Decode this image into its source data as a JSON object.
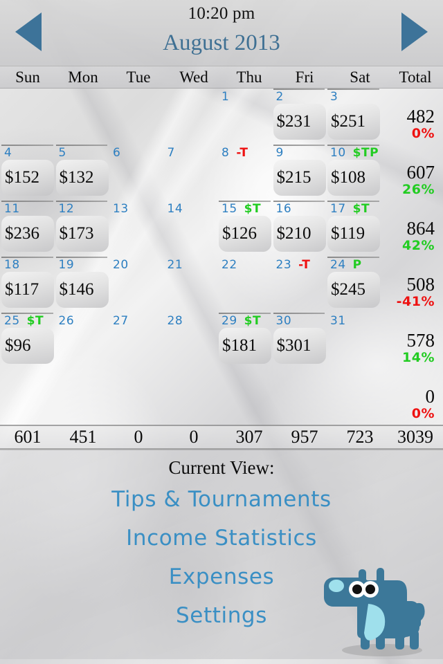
{
  "header": {
    "clock": "10:20 pm",
    "month_title": "August 2013",
    "prev_label": "prev-month",
    "next_label": "next-month"
  },
  "day_headers": [
    "Sun",
    "Mon",
    "Tue",
    "Wed",
    "Thu",
    "Fri",
    "Sat",
    "Total"
  ],
  "colors": {
    "accent_blue": "#3d7399",
    "daynum_blue": "#2d7fc1",
    "marker_green": "#22cc22",
    "marker_red": "#ee1111",
    "menu_blue": "#3a8fc4",
    "dog_body": "#3c7899",
    "dog_spot": "#9fe0ec"
  },
  "weeks": [
    {
      "days": [
        {
          "num": "",
          "amount": "",
          "marks": []
        },
        {
          "num": "",
          "amount": "",
          "marks": []
        },
        {
          "num": "",
          "amount": "",
          "marks": []
        },
        {
          "num": "",
          "amount": "",
          "marks": []
        },
        {
          "num": "1",
          "amount": "",
          "marks": []
        },
        {
          "num": "2",
          "amount": "$231",
          "marks": []
        },
        {
          "num": "3",
          "amount": "$251",
          "marks": []
        }
      ],
      "total": "482",
      "pct": "0%",
      "pct_sign": "neg"
    },
    {
      "days": [
        {
          "num": "4",
          "amount": "$152",
          "marks": []
        },
        {
          "num": "5",
          "amount": "$132",
          "marks": []
        },
        {
          "num": "6",
          "amount": "",
          "marks": []
        },
        {
          "num": "7",
          "amount": "",
          "marks": []
        },
        {
          "num": "8",
          "amount": "",
          "marks": [
            {
              "text": "-T",
              "color": "red"
            }
          ]
        },
        {
          "num": "9",
          "amount": "$215",
          "marks": []
        },
        {
          "num": "10",
          "amount": "$108",
          "marks": [
            {
              "text": "$TP",
              "color": "green"
            }
          ]
        }
      ],
      "total": "607",
      "pct": "26%",
      "pct_sign": "pos"
    },
    {
      "days": [
        {
          "num": "11",
          "amount": "$236",
          "marks": []
        },
        {
          "num": "12",
          "amount": "$173",
          "marks": []
        },
        {
          "num": "13",
          "amount": "",
          "marks": []
        },
        {
          "num": "14",
          "amount": "",
          "marks": []
        },
        {
          "num": "15",
          "amount": "$126",
          "marks": [
            {
              "text": "$T",
              "color": "green"
            }
          ]
        },
        {
          "num": "16",
          "amount": "$210",
          "marks": []
        },
        {
          "num": "17",
          "amount": "$119",
          "marks": [
            {
              "text": "$T",
              "color": "green"
            }
          ]
        }
      ],
      "total": "864",
      "pct": "42%",
      "pct_sign": "pos"
    },
    {
      "days": [
        {
          "num": "18",
          "amount": "$117",
          "marks": []
        },
        {
          "num": "19",
          "amount": "$146",
          "marks": []
        },
        {
          "num": "20",
          "amount": "",
          "marks": []
        },
        {
          "num": "21",
          "amount": "",
          "marks": []
        },
        {
          "num": "22",
          "amount": "",
          "marks": []
        },
        {
          "num": "23",
          "amount": "",
          "marks": [
            {
              "text": "-T",
              "color": "red"
            }
          ]
        },
        {
          "num": "24",
          "amount": "$245",
          "marks": [
            {
              "text": "P",
              "color": "green"
            }
          ]
        }
      ],
      "total": "508",
      "pct": "-41%",
      "pct_sign": "neg"
    },
    {
      "days": [
        {
          "num": "25",
          "amount": "$96",
          "marks": [
            {
              "text": "$T",
              "color": "green"
            }
          ]
        },
        {
          "num": "26",
          "amount": "",
          "marks": []
        },
        {
          "num": "27",
          "amount": "",
          "marks": []
        },
        {
          "num": "28",
          "amount": "",
          "marks": []
        },
        {
          "num": "29",
          "amount": "$181",
          "marks": [
            {
              "text": "$T",
              "color": "green"
            }
          ]
        },
        {
          "num": "30",
          "amount": "$301",
          "marks": []
        },
        {
          "num": "31",
          "amount": "",
          "marks": []
        }
      ],
      "total": "578",
      "pct": "14%",
      "pct_sign": "pos"
    },
    {
      "days": [
        {
          "num": "",
          "amount": "",
          "marks": []
        },
        {
          "num": "",
          "amount": "",
          "marks": []
        },
        {
          "num": "",
          "amount": "",
          "marks": []
        },
        {
          "num": "",
          "amount": "",
          "marks": []
        },
        {
          "num": "",
          "amount": "",
          "marks": []
        },
        {
          "num": "",
          "amount": "",
          "marks": []
        },
        {
          "num": "",
          "amount": "",
          "marks": []
        }
      ],
      "total": "0",
      "pct": "0%",
      "pct_sign": "neg"
    }
  ],
  "column_totals": [
    "601",
    "451",
    "0",
    "0",
    "307",
    "957",
    "723",
    "3039"
  ],
  "menu": {
    "title": "Current View:",
    "items": [
      {
        "label": "Tips & Tournaments"
      },
      {
        "label": "Income Statistics"
      },
      {
        "label": "Expenses"
      },
      {
        "label": "Settings"
      }
    ]
  }
}
